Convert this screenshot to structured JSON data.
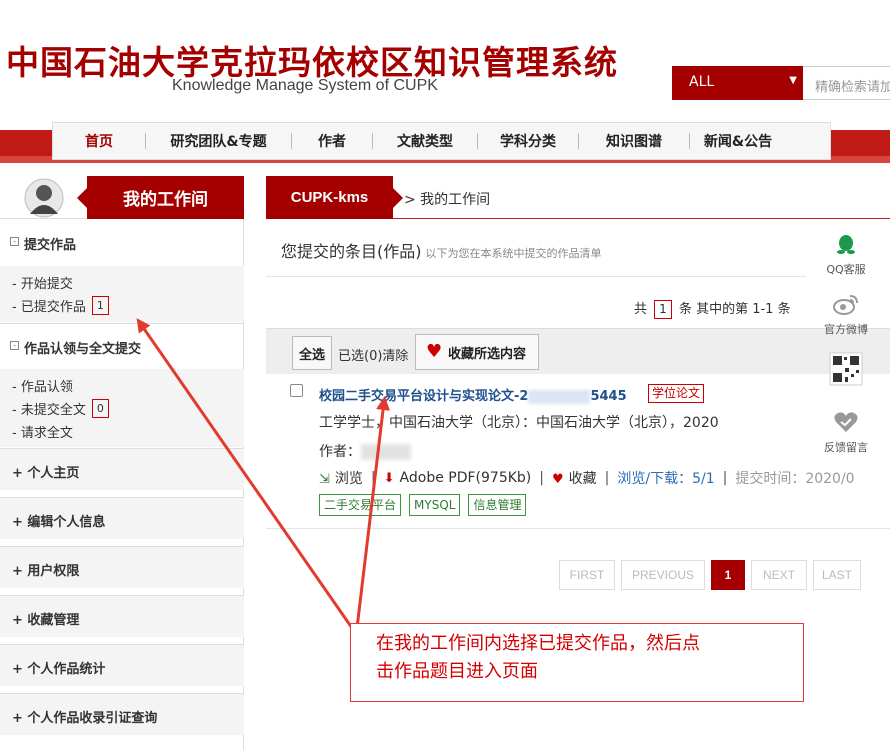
{
  "header": {
    "title": "中国石油大学克拉玛依校区知识管理系统",
    "subtitle": "Knowledge Manage System of CUPK",
    "search_scope": "ALL",
    "search_placeholder": "精确检索请加"
  },
  "nav": {
    "items": [
      "首页",
      "研究团队&专题",
      "作者",
      "文献类型",
      "学科分类",
      "知识图谱",
      "新闻&公告"
    ]
  },
  "sidebar": {
    "workspace_label": "我的工作间",
    "section1": {
      "title": "提交作品",
      "links": [
        {
          "label": "- 开始提交"
        },
        {
          "label": "- 已提交作品",
          "count": "1"
        }
      ]
    },
    "section2": {
      "title": "作品认领与全文提交",
      "links": [
        {
          "label": "- 作品认领"
        },
        {
          "label": "- 未提交全文",
          "count": "0"
        },
        {
          "label": "- 请求全文"
        }
      ]
    },
    "menu": [
      "+ 个人主页",
      "+ 编辑个人信息",
      "+ 用户权限",
      "+ 收藏管理",
      "+ 个人作品统计",
      "+ 个人作品收录引证查询"
    ]
  },
  "breadcrumb": {
    "site": "CUPK-kms",
    "current": "> 我的工作间"
  },
  "panel": {
    "title": "您提交的条目(作品)",
    "description": "以下为您在本系统中提交的作品清单",
    "count_prefix": "共",
    "count": "1",
    "count_suffix": "条 其中的第 1-1 条"
  },
  "toolbar": {
    "select_all": "全选",
    "selected": "已选(0)清除",
    "favorite_selected": "收藏所选内容"
  },
  "record": {
    "title_start": "校园二手交易平台设计与实现论文-2",
    "title_end": "5445",
    "type": "学位论文",
    "source": "工学学士，中国石油大学（北京）：中国石油大学（北京），2020",
    "author_label": "作者：",
    "browse": "浏览",
    "pdf": "Adobe PDF(975Kb)",
    "favorite": "收藏",
    "stats": "浏览/下载：5/1",
    "submit_time": "提交时间：2020/0",
    "tags": [
      "二手交易平台",
      "MYSQL",
      "信息管理"
    ]
  },
  "pager": {
    "first": "FIRST",
    "previous": "PREVIOUS",
    "current": "1",
    "next": "NEXT",
    "last": "LAST"
  },
  "floating": {
    "qq": "QQ客服",
    "weibo": "官方微博",
    "feedback": "反馈留言"
  },
  "annotation": {
    "line1": "在我的工作间内选择已提交作品，然后点",
    "line2": "击作品题目进入页面"
  },
  "colors": {
    "brand": "#a50000",
    "nav_band": "#c11b17",
    "link": "#1f4f8f",
    "tag_green": "#2e7d2e",
    "annotation_red": "#d40000"
  }
}
